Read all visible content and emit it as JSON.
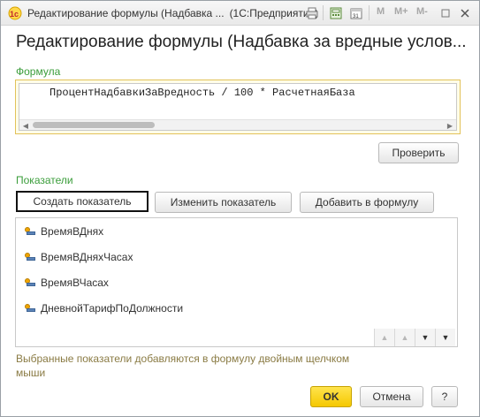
{
  "titlebar": {
    "title": "Редактирование формулы (Надбавка ...",
    "app": "(1С:Предприятие)",
    "mem_labels": [
      "M",
      "M+",
      "M-"
    ]
  },
  "form": {
    "title": "Редактирование формулы (Надбавка за вредные услов..."
  },
  "formula": {
    "label": "Формула",
    "text": "ПроцентНадбавкиЗаВредность / 100 * РасчетнаяБаза"
  },
  "buttons": {
    "check": "Проверить",
    "create": "Создать показатель",
    "edit": "Изменить показатель",
    "add": "Добавить в формулу",
    "ok": "OK",
    "cancel": "Отмена",
    "help": "?"
  },
  "indicators": {
    "label": "Показатели",
    "items": [
      "ВремяВДнях",
      "ВремяВДняхЧасах",
      "ВремяВЧасах",
      "ДневнойТарифПоДолжности"
    ]
  },
  "hint": "Выбранные показатели добавляются в формулу двойным щелчком мыши",
  "colors": {
    "section_label": "#3a9d3a",
    "hint": "#8a7b44",
    "ok_button": "#f5c800",
    "formula_border": "#e2c25a"
  }
}
